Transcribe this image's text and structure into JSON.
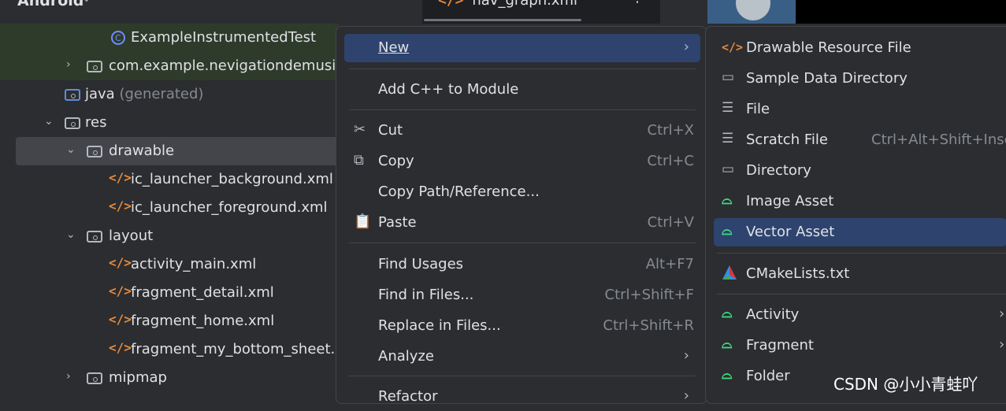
{
  "header": {
    "title": "Android",
    "tab": "nav_graph.xml"
  },
  "tree": [
    {
      "label": "ExampleInstrumentedTest",
      "suffix": ""
    },
    {
      "label": "com.example.nevigationdemusic",
      "suffix": ""
    },
    {
      "label": "java",
      "suffix": " (generated)"
    },
    {
      "label": "res",
      "suffix": ""
    },
    {
      "label": "drawable",
      "suffix": ""
    },
    {
      "label": "ic_launcher_background.xml",
      "suffix": ""
    },
    {
      "label": "ic_launcher_foreground.xml",
      "suffix": ""
    },
    {
      "label": "layout",
      "suffix": ""
    },
    {
      "label": "activity_main.xml",
      "suffix": ""
    },
    {
      "label": "fragment_detail.xml",
      "suffix": ""
    },
    {
      "label": "fragment_home.xml",
      "suffix": ""
    },
    {
      "label": "fragment_my_bottom_sheet.xml",
      "suffix": ""
    },
    {
      "label": "mipmap",
      "suffix": ""
    }
  ],
  "menu": [
    {
      "label": "New",
      "shortcut": ""
    },
    {
      "label": "Add C++ to Module",
      "shortcut": ""
    },
    {
      "label": "Cut",
      "shortcut": "Ctrl+X"
    },
    {
      "label": "Copy",
      "shortcut": "Ctrl+C"
    },
    {
      "label": "Copy Path/Reference...",
      "shortcut": ""
    },
    {
      "label": "Paste",
      "shortcut": "Ctrl+V"
    },
    {
      "label": "Find Usages",
      "shortcut": "Alt+F7"
    },
    {
      "label": "Find in Files...",
      "shortcut": "Ctrl+Shift+F"
    },
    {
      "label": "Replace in Files...",
      "shortcut": "Ctrl+Shift+R"
    },
    {
      "label": "Analyze",
      "shortcut": ""
    },
    {
      "label": "Refactor",
      "shortcut": ""
    }
  ],
  "submenu": [
    {
      "label": "Drawable Resource File",
      "shortcut": ""
    },
    {
      "label": "Sample Data Directory",
      "shortcut": ""
    },
    {
      "label": "File",
      "shortcut": ""
    },
    {
      "label": "Scratch File",
      "shortcut": "Ctrl+Alt+Shift+Insert"
    },
    {
      "label": "Directory",
      "shortcut": ""
    },
    {
      "label": "Image Asset",
      "shortcut": ""
    },
    {
      "label": "Vector Asset",
      "shortcut": ""
    },
    {
      "label": "CMakeLists.txt",
      "shortcut": ""
    },
    {
      "label": "Activity",
      "shortcut": ""
    },
    {
      "label": "Fragment",
      "shortcut": ""
    },
    {
      "label": "Folder",
      "shortcut": ""
    }
  ],
  "watermark": "CSDN @小小青蛙吖"
}
